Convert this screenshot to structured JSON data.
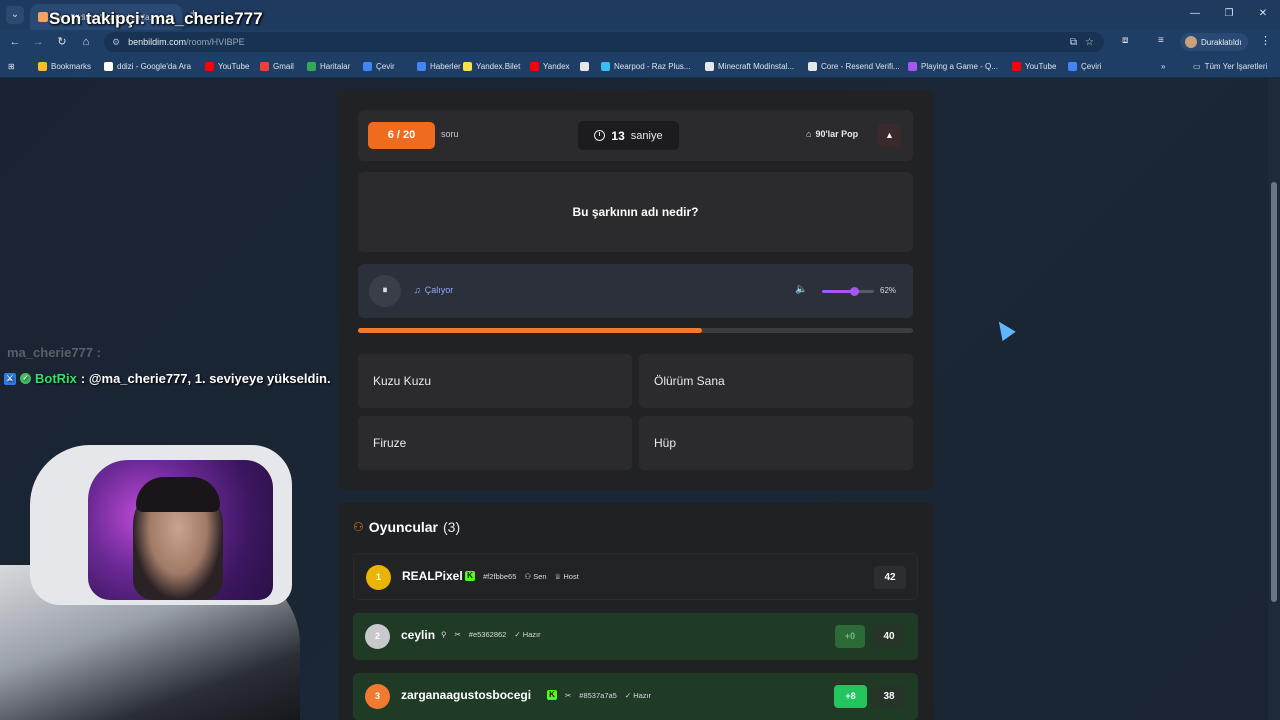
{
  "browser": {
    "tab_title": "Ben Bildim | Arkadaşlarınla...",
    "stream_overlay_title": "Son takipçi: ma_cherie777",
    "url_host": "benbildim.com",
    "url_path": "/room/HVIBPE",
    "profile_label": "Duraklatıldı",
    "bookmarks": [
      {
        "label": "Bookmarks",
        "color": "#fbbf24"
      },
      {
        "label": "ddizi - Google'da Ara",
        "color": "#ffffff"
      },
      {
        "label": "YouTube",
        "color": "#ff0000"
      },
      {
        "label": "Gmail",
        "color": "#ea4335"
      },
      {
        "label": "Haritalar",
        "color": "#34a853"
      },
      {
        "label": "Çevir",
        "color": "#4285f4"
      },
      {
        "label": "Haberler",
        "color": "#4285f4"
      },
      {
        "label": "Yandex.Bilet",
        "color": "#fde047"
      },
      {
        "label": "Yandex",
        "color": "#ff0000"
      },
      {
        "label": "",
        "color": "#e5e7eb"
      },
      {
        "label": "Nearpod - Raz Plus...",
        "color": "#38bdf8"
      },
      {
        "label": "Minecraft Modinstal...",
        "color": "#e5e7eb"
      },
      {
        "label": "Core - Resend Verifi...",
        "color": "#e5e7eb"
      },
      {
        "label": "Playing a Game - Q...",
        "color": "#a855f7"
      },
      {
        "label": "YouTube",
        "color": "#ff0000"
      },
      {
        "label": "Çeviri",
        "color": "#4285f4"
      }
    ],
    "all_bookmarks_label": "Tüm Yer İşaretleri"
  },
  "game": {
    "question_counter": "6 / 20",
    "question_unit": "soru",
    "timer_value": "13",
    "timer_unit": "saniye",
    "category": "90'lar Pop",
    "question": "Bu şarkının adı nedir?",
    "player_status": "Çalıyor",
    "volume_text": "62%",
    "volume_level": 0.62,
    "song_progress": 0.62,
    "answers": [
      "Kuzu Kuzu",
      "Ölürüm Sana",
      "Firuze",
      "Hüp"
    ]
  },
  "players": {
    "title": "Oyuncular",
    "count": "(3)",
    "rows": [
      {
        "rank": "1",
        "name": "REALPixel",
        "id": "#f2fbbe65",
        "tags": [
          "Sen",
          "Host"
        ],
        "delta": "",
        "score": "42",
        "rank_color": "#eab308",
        "row_bg": "#222325"
      },
      {
        "rank": "2",
        "name": "ceylin",
        "id": "#e5362862",
        "tags": [
          "Hazır"
        ],
        "delta": "+0",
        "score": "40",
        "rank_color": "#c7c9cc",
        "row_bg": "#1f3b26"
      },
      {
        "rank": "3",
        "name": "zarganaagustosbocegi",
        "id": "#8537a7a5",
        "tags": [
          "Hazır"
        ],
        "delta": "+8",
        "score": "38",
        "rank_color": "#f07a30",
        "row_bg": "#1f3b26"
      }
    ]
  },
  "overlay": {
    "chat_ghost": "ma_cherie777 :",
    "chat_user": "BotRix",
    "chat_msg": ": @ma_cherie777, 1. seviyeye yükseldin."
  }
}
